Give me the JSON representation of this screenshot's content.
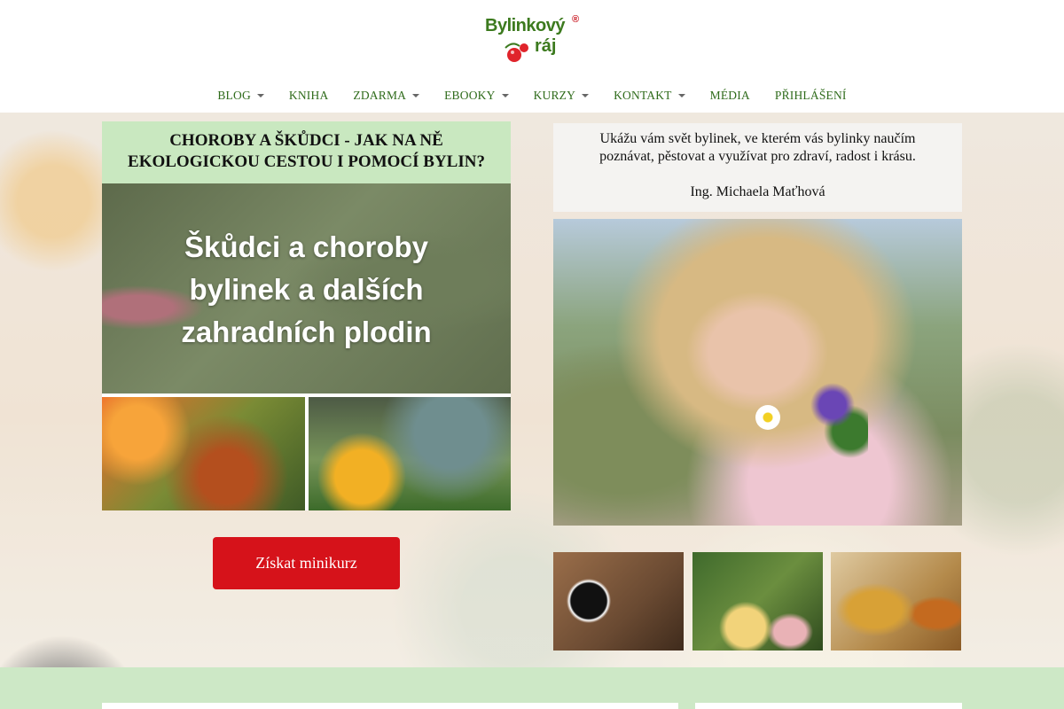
{
  "brand": {
    "name_line1": "Bylinkový",
    "name_line2": "ráj",
    "registered_mark": "®",
    "accent_green": "#3c7a1e",
    "accent_red": "#c8141e"
  },
  "nav": {
    "items": [
      {
        "label": "BLOG",
        "has_dropdown": true
      },
      {
        "label": "KNIHA",
        "has_dropdown": false
      },
      {
        "label": "ZDARMA",
        "has_dropdown": true
      },
      {
        "label": "EBOOKY",
        "has_dropdown": true
      },
      {
        "label": "KURZY",
        "has_dropdown": true
      },
      {
        "label": "KONTAKT",
        "has_dropdown": true
      },
      {
        "label": "MÉDIA",
        "has_dropdown": false
      },
      {
        "label": "PŘIHLÁŠENÍ",
        "has_dropdown": false
      }
    ],
    "color": "#2f6b1b"
  },
  "hero": {
    "left_title": {
      "line1": "CHOROBY A ŠKŮDCI - JAK NA NĚ",
      "line2": "EKOLOGICKOU CESTOU I POMOCÍ BYLIN?"
    },
    "book_cover": {
      "line1": "Škůdci a choroby",
      "line2": "bylinek a dalších",
      "line3": "zahradních plodin"
    },
    "cta_label": "Získat minikurz",
    "cta_color": "#d6121a",
    "intro": {
      "line1": "Ukážu vám svět bylinek, ve kterém vás bylinky naučím",
      "line2": "poznávat, pěstovat a využívat pro zdraví, radost i krásu.",
      "author": "Ing. Michaela Maťhová"
    }
  },
  "colors": {
    "title_bg": "#c9e8c0",
    "band_bg": "#cde8c6"
  }
}
